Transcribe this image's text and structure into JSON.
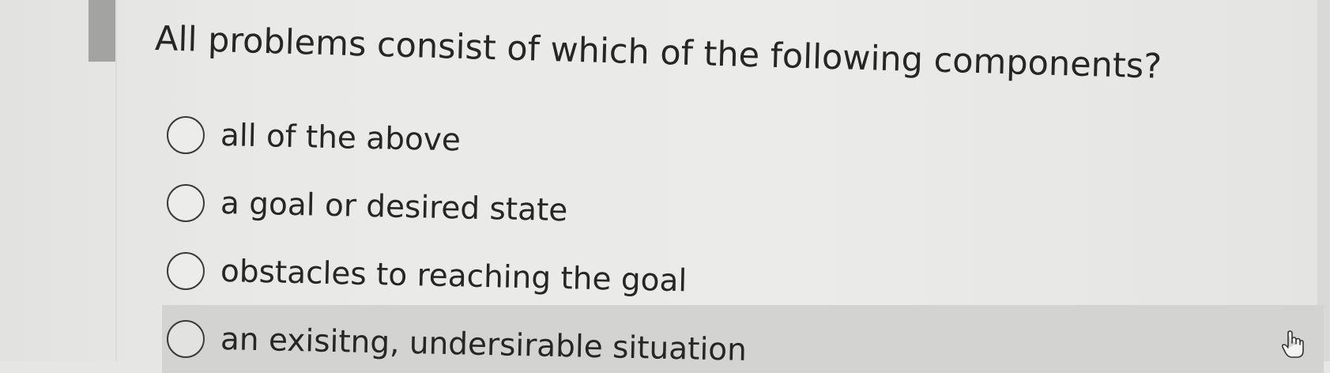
{
  "question": {
    "text": "All problems consist of which of the following components?"
  },
  "options": [
    {
      "label": "all of the above",
      "selected": false,
      "highlighted": false
    },
    {
      "label": "a goal or desired state",
      "selected": false,
      "highlighted": false
    },
    {
      "label": "obstacles to reaching the goal",
      "selected": false,
      "highlighted": false
    },
    {
      "label": "an exisitng, undersirable situation",
      "selected": false,
      "highlighted": true
    }
  ],
  "cursor": {
    "icon": "hand-pointer-icon"
  },
  "colors": {
    "background": "#e9e9e7",
    "highlight": "#d3d3d1",
    "text": "#262626"
  }
}
